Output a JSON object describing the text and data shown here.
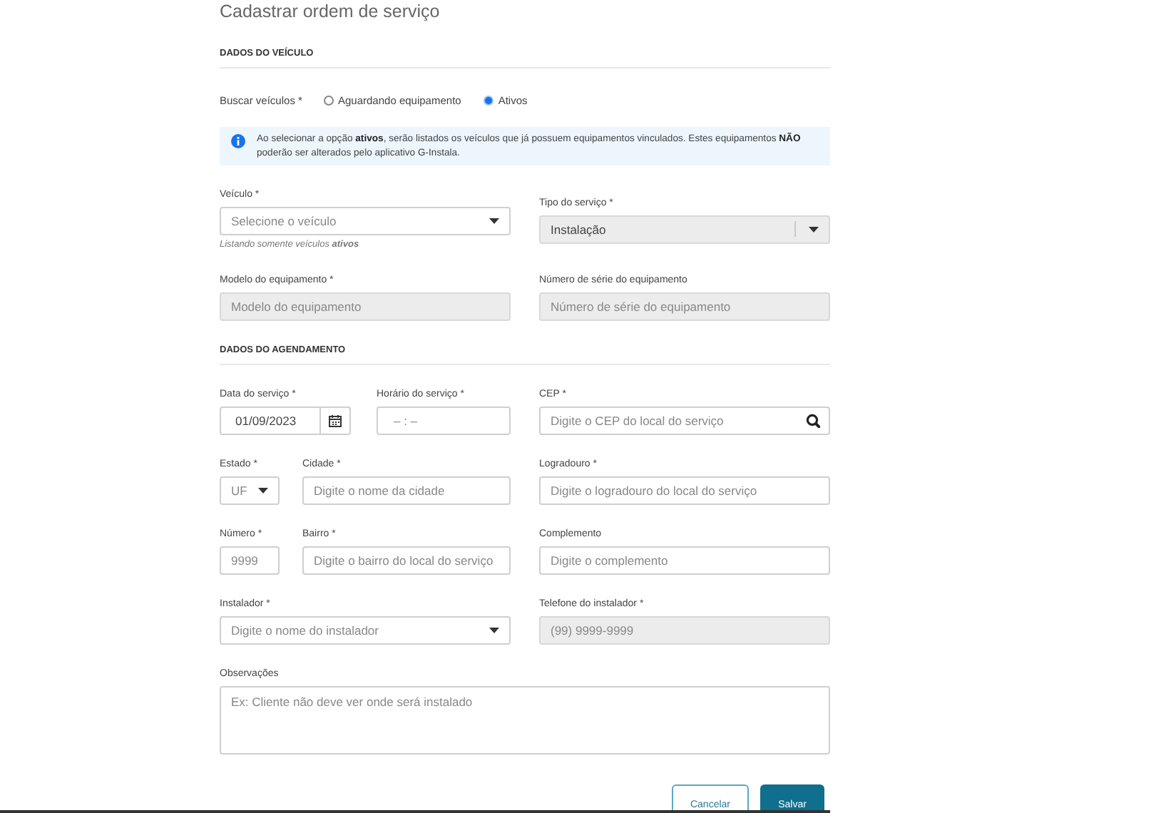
{
  "page_title": "Cadastrar ordem de serviço",
  "sections": [
    {
      "title": "DADOS DO VEÍCULO",
      "rows": [
        {
          "kind": "radio",
          "label": "Buscar veículos *",
          "options": [
            {
              "label": "Aguardando equipamento",
              "selected": false
            },
            {
              "label": "Ativos",
              "selected": true
            }
          ]
        },
        {
          "kind": "info",
          "text": "Ao selecionar a opção **ativos**, serão listados os veículos que já possuem equipamentos vinculados. Estes equipamentos **NÃO** poderão ser alterados pelo aplicativo G-Instala."
        },
        {
          "kind": "fields",
          "left": [
            {
              "label": "Veículo *",
              "kind": "select",
              "placeholder": "Selecione o veículo",
              "disabled": false,
              "helper": "Listando somente veículos **ativos**"
            }
          ],
          "right": [
            {
              "label": "Tipo do serviço *",
              "kind": "select",
              "value": "Instalação",
              "disabled": true
            }
          ]
        },
        {
          "kind": "fields",
          "left": [
            {
              "label": "Modelo do equipamento *",
              "kind": "text",
              "placeholder": "Modelo do equipamento",
              "disabled": true
            }
          ],
          "right": [
            {
              "label": "Número de série do equipamento",
              "kind": "text",
              "placeholder": "Número de série do equipamento",
              "disabled": true
            }
          ]
        }
      ]
    },
    {
      "title": "DADOS DO AGENDAMENTO",
      "rows": [
        {
          "kind": "fields",
          "left": [
            {
              "label": "Data do serviço *",
              "kind": "date",
              "value": "01/09/2023",
              "disabled": false
            },
            {
              "label": "Horário do serviço *",
              "kind": "time",
              "placeholder": "–  :  –",
              "disabled": false
            }
          ],
          "right": [
            {
              "label": "CEP *",
              "kind": "search",
              "placeholder": "Digite o CEP do local do serviço",
              "disabled": false
            }
          ]
        },
        {
          "kind": "fields",
          "left": [
            {
              "label": "Estado *",
              "kind": "select",
              "placeholder": "UF",
              "disabled": false
            },
            {
              "label": "Cidade *",
              "kind": "text",
              "placeholder": "Digite o nome da cidade",
              "disabled": false
            }
          ],
          "right": [
            {
              "label": "Logradouro *",
              "kind": "text",
              "placeholder": "Digite o logradouro do local do serviço",
              "disabled": false
            }
          ]
        },
        {
          "kind": "fields",
          "left": [
            {
              "label": "Número *",
              "kind": "text",
              "placeholder": "9999",
              "disabled": false
            },
            {
              "label": "Bairro *",
              "kind": "text",
              "placeholder": "Digite o bairro do local do serviço",
              "disabled": false
            }
          ],
          "right": [
            {
              "label": "Complemento",
              "kind": "text",
              "placeholder": "Digite o complemento",
              "disabled": false
            }
          ]
        },
        {
          "kind": "fields",
          "left": [
            {
              "label": "Instalador *",
              "kind": "select",
              "placeholder": "Digite o nome do instalador",
              "disabled": false
            }
          ],
          "right": [
            {
              "label": "Telefone do instalador *",
              "kind": "text",
              "placeholder": "(99) 9999-9999",
              "disabled": true
            }
          ]
        },
        {
          "kind": "full",
          "field": {
            "label": "Observações",
            "kind": "textarea",
            "placeholder": "Ex: Cliente não deve ver onde será instalado",
            "disabled": false
          }
        }
      ]
    }
  ],
  "buttons": [
    {
      "label": "Cancelar",
      "kind": "secondary"
    },
    {
      "label": "Salvar",
      "kind": "primary"
    }
  ]
}
